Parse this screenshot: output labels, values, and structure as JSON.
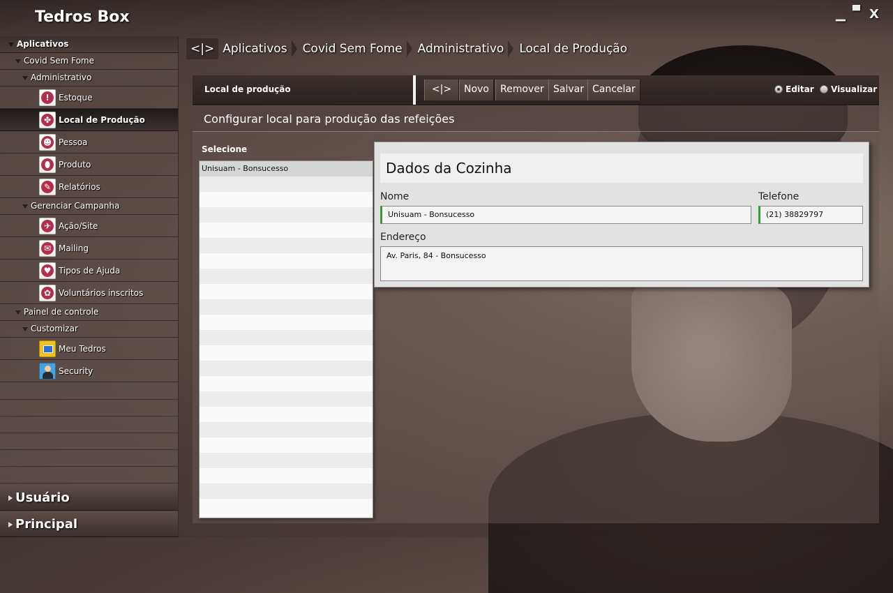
{
  "app": {
    "title": "Tedros Box",
    "window_controls": {
      "minimize": "▁",
      "restore": "▀",
      "close": "X"
    }
  },
  "sidebar": {
    "header": "Aplicativos",
    "tree": [
      {
        "label": "Covid Sem Fome"
      },
      {
        "label": "Administrativo"
      },
      {
        "label": "Estoque",
        "icon": "alert-icon",
        "glyph": "!"
      },
      {
        "label": "Local de Produção",
        "icon": "cutlery-icon",
        "glyph": "✤",
        "selected": true
      },
      {
        "label": "Pessoa",
        "icon": "people-icon",
        "glyph": "☻"
      },
      {
        "label": "Produto",
        "icon": "bag-icon",
        "glyph": "⬮"
      },
      {
        "label": "Relatórios",
        "icon": "chart-icon",
        "glyph": "✎"
      },
      {
        "label": "Gerenciar Campanha"
      },
      {
        "label": "Ação/Site",
        "icon": "megaphone-icon",
        "glyph": "✈"
      },
      {
        "label": "Mailing",
        "icon": "mail-icon",
        "glyph": "✉"
      },
      {
        "label": "Tipos de Ajuda",
        "icon": "heart-icon",
        "glyph": "♥"
      },
      {
        "label": "Voluntários inscritos",
        "icon": "volunteers-icon",
        "glyph": "✿"
      },
      {
        "label": "Painel de controle"
      },
      {
        "label": "Customizar"
      },
      {
        "label": "Meu Tedros",
        "icon": "windows-icon"
      },
      {
        "label": "Security",
        "icon": "user-security-icon"
      }
    ],
    "sections": [
      "Usuário",
      "Principal"
    ]
  },
  "breadcrumb": [
    "<|>",
    "Aplicativos",
    "Covid Sem Fome",
    "Administrativo",
    "Local de Produção"
  ],
  "toolbar": {
    "title": "Local de produção",
    "buttons": [
      "<|>",
      "Novo",
      "Remover",
      "Salvar",
      "Cancelar"
    ],
    "mode": {
      "edit": "Editar",
      "view": "Visualizar",
      "selected": "edit"
    }
  },
  "subtitle": "Configurar local para produção das refeições",
  "list": {
    "header": "Selecione",
    "items": [
      "Unisuam - Bonsucesso"
    ]
  },
  "form": {
    "title": "Dados da Cozinha",
    "nome_label": "Nome",
    "nome_value": "Unisuam - Bonsucesso",
    "telefone_label": "Telefone",
    "telefone_value": "(21) 38829797",
    "endereco_label": "Endereço",
    "endereco_value": "Av. Paris, 84 - Bonsucesso"
  },
  "colors": {
    "accent_required": "#3a9a3a",
    "icon_red": "#b52d4c"
  }
}
